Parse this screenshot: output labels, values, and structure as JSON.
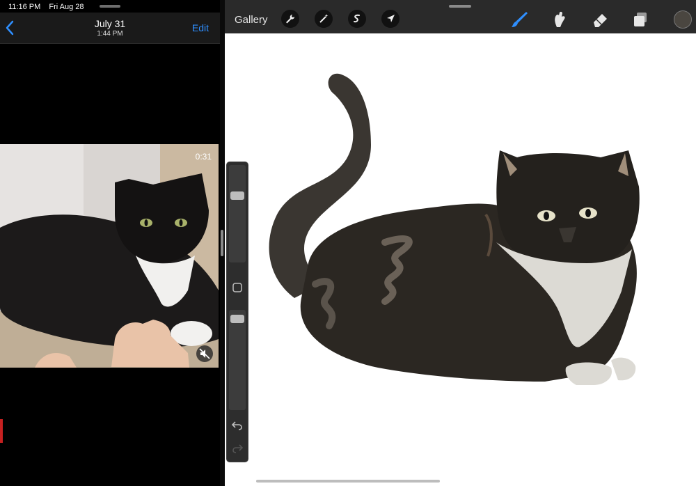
{
  "status": {
    "time": "11:16 PM",
    "date": "Fri Aug 28"
  },
  "photos": {
    "back_icon": "chevron-left-icon",
    "title": "July 31",
    "subtitle": "1:44 PM",
    "edit_label": "Edit",
    "video_duration": "0:31",
    "mute_icon": "mute-icon"
  },
  "procreate": {
    "gallery_label": "Gallery",
    "left_tools": [
      "wrench-icon",
      "magic-wand-icon",
      "selection-icon",
      "transform-arrow-icon"
    ],
    "right_tools": [
      "brush-icon",
      "smudge-icon",
      "eraser-icon",
      "layers-icon"
    ],
    "active_tool": "brush-icon",
    "color": "#4a4640",
    "accent": "#2f8fff",
    "sidebar": {
      "brush_size_level": 0.3,
      "opacity_level": 0.05
    }
  }
}
